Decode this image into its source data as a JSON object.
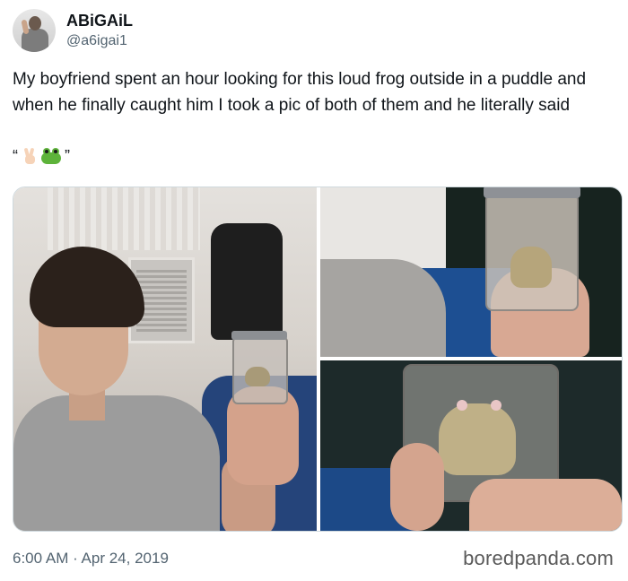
{
  "author": {
    "display_name": "ABiGAiL",
    "handle": "@a6igai1"
  },
  "tweet": {
    "text": "My boyfriend spent an hour looking for this loud frog outside in a puddle and when he finally caught him I took a pic of both of them and he literally said",
    "quote_open": "“",
    "quote_close": "”",
    "emoji": [
      "peace-hand",
      "frog-face"
    ],
    "timestamp": "6:00 AM · Apr 24, 2019"
  },
  "media": {
    "photos": [
      "man-holding-frog-jar",
      "frog-jar-close-up-1",
      "frog-jar-close-up-2"
    ]
  },
  "watermark": "boredpanda.com"
}
